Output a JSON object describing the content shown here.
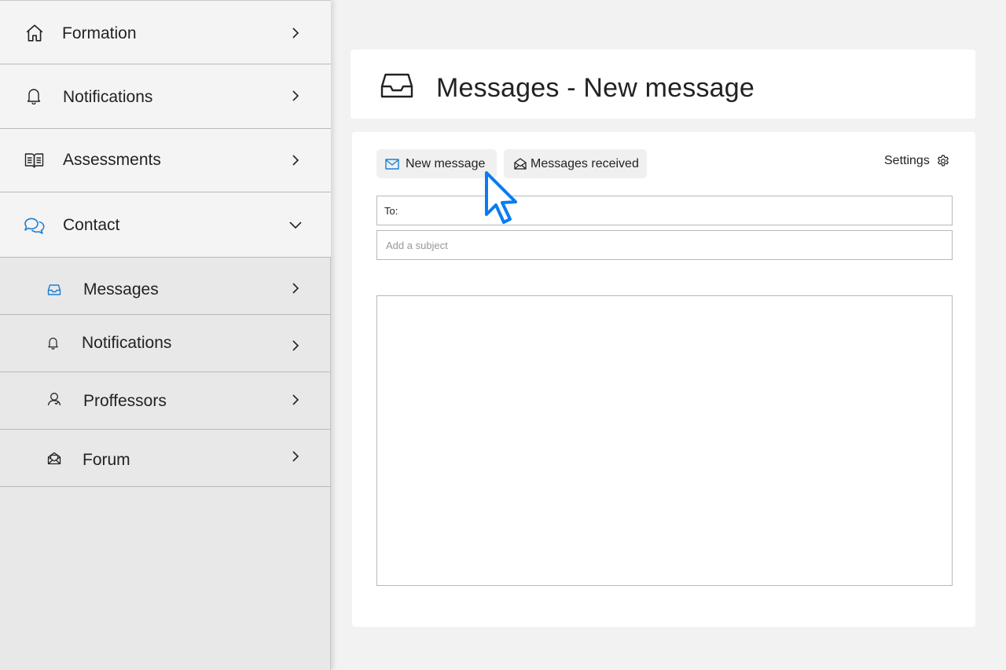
{
  "sidebar": {
    "items": [
      {
        "label": "Formation",
        "icon": "home-icon"
      },
      {
        "label": "Notifications",
        "icon": "bell-icon"
      },
      {
        "label": "Assessments",
        "icon": "book-icon"
      },
      {
        "label": "Contact",
        "icon": "chat-icon",
        "expanded": true
      }
    ],
    "sub_items": [
      {
        "label": "Messages",
        "icon": "inbox-icon",
        "active": true
      },
      {
        "label": "Notifications",
        "icon": "bell-icon"
      },
      {
        "label": "Proffessors",
        "icon": "user-icon"
      },
      {
        "label": "Forum",
        "icon": "envelope-open-icon"
      }
    ]
  },
  "header": {
    "title": "Messages - New message",
    "icon": "inbox-icon"
  },
  "compose": {
    "tabs": {
      "new_message": "New message",
      "messages_received": "Messages received"
    },
    "settings_label": "Settings",
    "to_label": "To:",
    "to_value": "",
    "subject_placeholder": "Add a subject",
    "body_value": ""
  },
  "colors": {
    "accent": "#1a7fd6",
    "cursor": "#0a7cf0",
    "sidebar_bg": "#e8e8e8",
    "page_bg": "#f2f2f2"
  }
}
